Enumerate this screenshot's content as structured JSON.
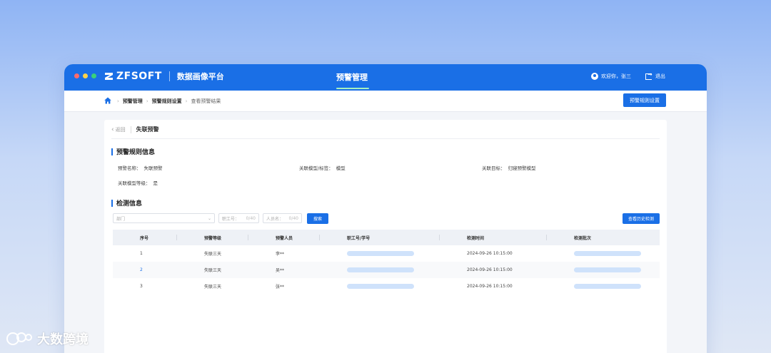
{
  "window": {
    "brand": {
      "name": "ZFSOFT",
      "subtitle": "数据画像平台"
    },
    "nav_title": "预警管理",
    "user": {
      "greeting": "欢迎你，张三"
    },
    "logout_label": "退出"
  },
  "breadcrumb": {
    "items": [
      "预警管理",
      "预警规则设置",
      "查看预警结果"
    ]
  },
  "toolbar": {
    "rule_settings_label": "预警规则设置"
  },
  "detail": {
    "back_label": "返回",
    "title": "失联预警",
    "rule_section_title": "预警规则信息",
    "fields": {
      "name_key": "预警名称：",
      "name_value": "失联预警",
      "model_key": "关联模型/标签：",
      "model_value": "模型",
      "target_key": "关联目标：",
      "target_value": "归寝预警模型",
      "level_key": "关联模型等级：",
      "level_value": "是"
    },
    "detect_section_title": "检测信息"
  },
  "filters": {
    "dept_placeholder": "部门",
    "staff_placeholder": "职工号：",
    "staff_count": "0/40",
    "name_placeholder": "人员名：",
    "name_count": "0/40",
    "search_label": "搜索",
    "history_label": "查看历史检测"
  },
  "table": {
    "headers": [
      "序号",
      "预警等级",
      "预警人员",
      "职工号/学号",
      "检测时间",
      "检测批次"
    ],
    "rows": [
      {
        "no": "1",
        "level": "失联三天",
        "person": "李**",
        "time": "2024-09-26  10:15:00"
      },
      {
        "no": "2",
        "level": "失联三天",
        "person": "吴**",
        "time": "2024-09-26  10:15:00"
      },
      {
        "no": "3",
        "level": "失联三天",
        "person": "张**",
        "time": "2024-09-26  10:15:00"
      }
    ]
  },
  "watermark": {
    "text": "大数跨境"
  },
  "colors": {
    "primary": "#1a6fe6",
    "nav_underline": "#a6f0c0",
    "blur_placeholder": "#cfe2fb"
  }
}
